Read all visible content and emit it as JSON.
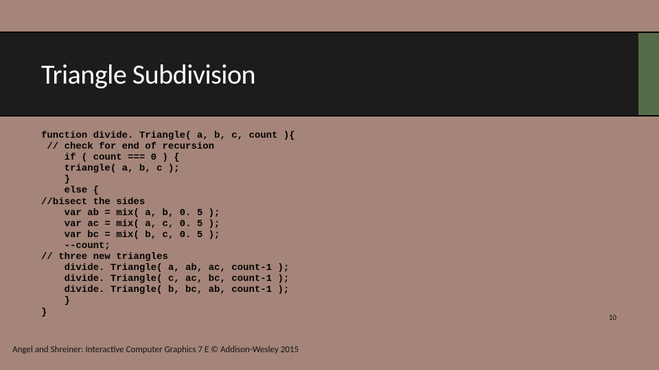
{
  "title": "Triangle Subdivision",
  "code": "function divide. Triangle( a, b, c, count ){\n // check for end of recursion\n    if ( count === 0 ) {\n    triangle( a, b, c );\n    }\n    else {\n//bisect the sides\n    var ab = mix( a, b, 0. 5 );\n    var ac = mix( a, c, 0. 5 );\n    var bc = mix( b, c, 0. 5 );\n    --count;\n// three new triangles\n    divide. Triangle( a, ab, ac, count-1 );\n    divide. Triangle( c, ac, bc, count-1 );\n    divide. Triangle( b, bc, ab, count-1 );\n    }\n}",
  "page_number": "10",
  "footer": "Angel and Shreiner: Interactive Computer Graphics 7 E © Addison-Wesley 2015"
}
